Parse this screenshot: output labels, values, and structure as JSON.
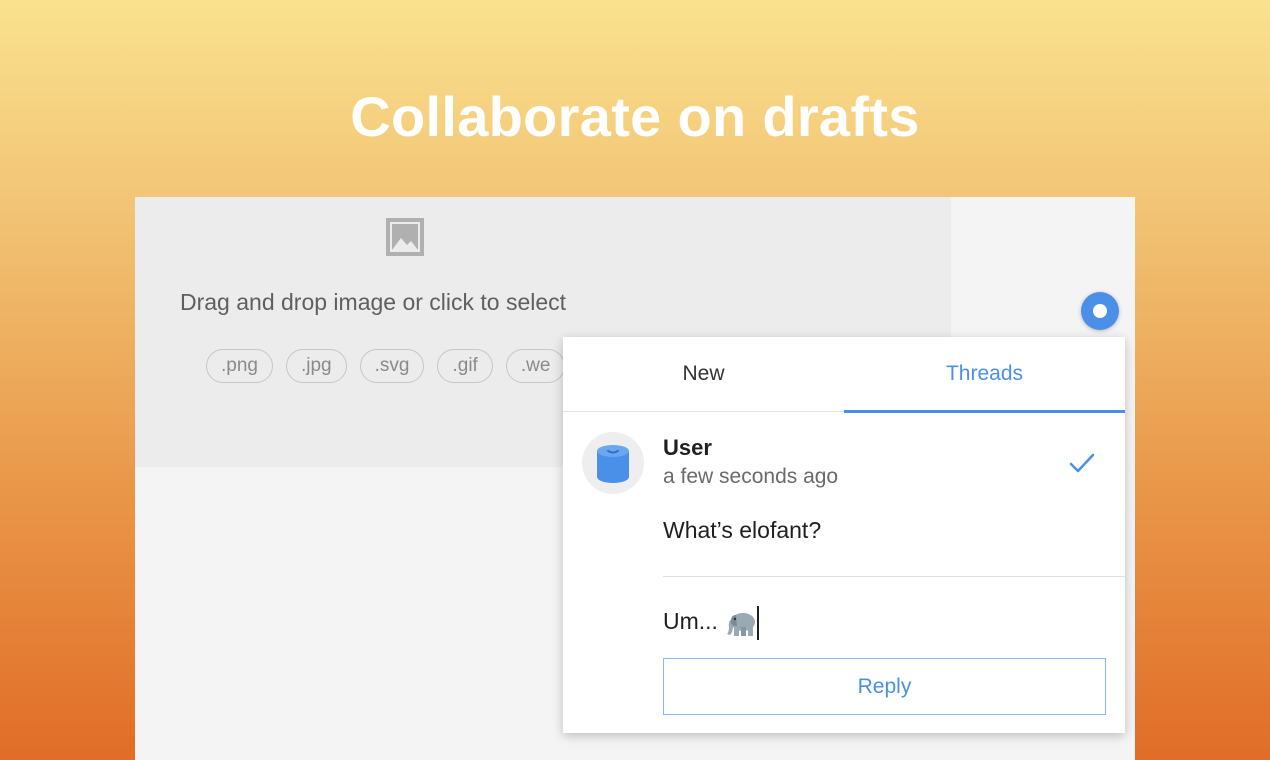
{
  "headline": "Collaborate on drafts",
  "dropzone": {
    "icon": "image-icon",
    "instruction": "Drag and drop image or click to select",
    "formats": [
      ".png",
      ".jpg",
      ".svg",
      ".gif",
      ".we"
    ]
  },
  "comment_marker": {
    "icon": "comment-dot-icon",
    "color": "#4a8fe8"
  },
  "panel": {
    "tabs": [
      {
        "label": "New",
        "active": false
      },
      {
        "label": "Threads",
        "active": true
      }
    ],
    "thread": {
      "avatar": "database-avatar-icon",
      "author": "User",
      "time": "a few seconds ago",
      "resolve_icon": "checkmark-icon",
      "message": "What’s elofant?"
    },
    "reply": {
      "draft_text": "Um...",
      "emoji": "elephant-emoji-icon",
      "button_label": "Reply"
    }
  },
  "colors": {
    "accent": "#4a8fe8",
    "gradient_top": "#f9e28f",
    "gradient_bottom": "#e06d28"
  }
}
